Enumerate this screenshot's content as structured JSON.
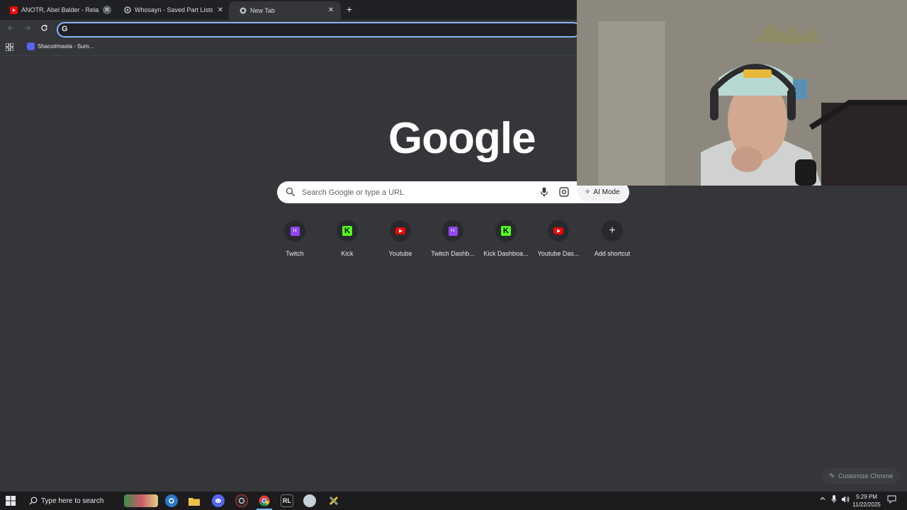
{
  "tabs": [
    {
      "title": "ANOTR, Abel Balder - Relax My",
      "favicon": "youtube-icon"
    },
    {
      "title": "Whosayn - Saved Part Lists - PC",
      "favicon": "pcpartpicker-icon"
    },
    {
      "title": "New Tab",
      "favicon": "chrome-icon"
    }
  ],
  "omnibox": {
    "value": "",
    "placeholder": ""
  },
  "bookmarks": [
    {
      "label": "Shaco#masta - Sum..."
    }
  ],
  "logo": "Google",
  "search": {
    "placeholder": "Search Google or type a URL",
    "ai_mode_label": "AI Mode"
  },
  "shortcuts": [
    {
      "label": "Twitch",
      "icon": "twitch-icon"
    },
    {
      "label": "Kick",
      "icon": "kick-icon"
    },
    {
      "label": "Youtube",
      "icon": "youtube-icon"
    },
    {
      "label": "Twitch Dashb...",
      "icon": "twitch-icon"
    },
    {
      "label": "Kick Dashboa...",
      "icon": "kick-icon"
    },
    {
      "label": "Youtube Das...",
      "icon": "youtube-icon"
    },
    {
      "label": "Add shortcut",
      "icon": "plus-icon"
    }
  ],
  "kick_letter": "K",
  "customize_label": "Customize Chrome",
  "taskbar": {
    "search_placeholder": "Type here to search",
    "rl_label": "RL",
    "time": "5:29 PM",
    "date": "11/22/2025"
  },
  "colors": {
    "background": "#35363a",
    "tabstrip": "#202124",
    "accent": "#8ab4f8",
    "twitch": "#9146ff",
    "kick": "#53fc18",
    "youtube": "#ff0000"
  }
}
